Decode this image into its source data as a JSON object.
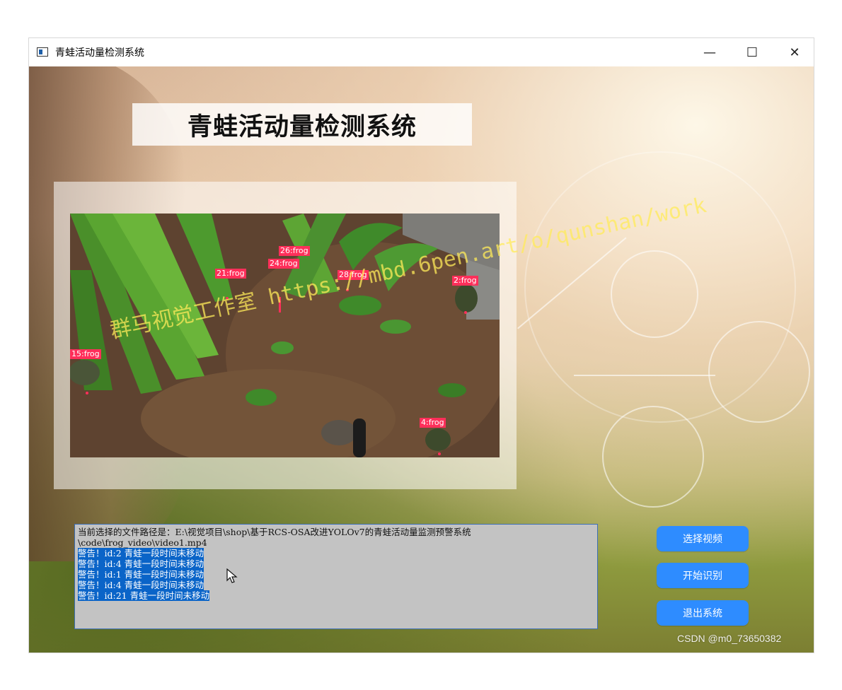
{
  "window": {
    "title": "青蛙活动量检测系统"
  },
  "header": {
    "title": "青蛙活动量检测系统"
  },
  "detections": [
    {
      "label": "26:frog"
    },
    {
      "label": "24:frog"
    },
    {
      "label": "21:frog"
    },
    {
      "label": "28:frog"
    },
    {
      "label": "2:frog"
    },
    {
      "label": "15:frog"
    },
    {
      "label": "4:frog"
    }
  ],
  "video": {
    "watermark": "群马视觉工作室 https://mbd.6pen.art/o/qunshan/work"
  },
  "log": {
    "path_line1": "当前选择的文件路径是：E:\\视觉项目\\shop\\基于RCS-OSA改进YOLOv7的青蛙活动量监测预警系统",
    "path_line2": "\\code\\frog_video\\video1.mp4",
    "warnings": [
      "警告！id:2 青蛙一段时间未移动",
      "警告！id:4 青蛙一段时间未移动",
      "警告！id:1 青蛙一段时间未移动",
      "警告！id:4 青蛙一段时间未移动",
      "警告！id:21 青蛙一段时间未移动"
    ]
  },
  "buttons": {
    "select_video": "选择视频",
    "start_detect": "开始识别",
    "exit_system": "退出系统"
  },
  "footer": {
    "watermark": "CSDN @m0_73650382"
  },
  "colors": {
    "button": "#2e8cff",
    "selection": "#0a64c8",
    "detection_box": "#ff2f5a"
  }
}
